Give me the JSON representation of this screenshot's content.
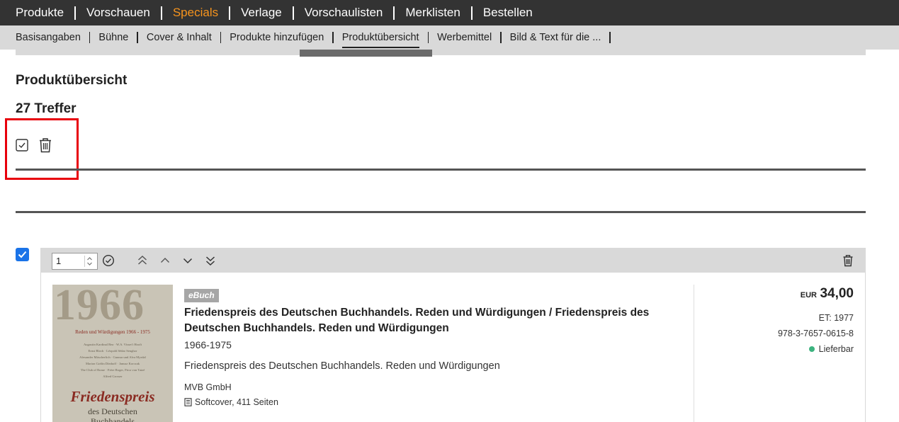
{
  "top_nav": {
    "items": [
      {
        "label": "Produkte",
        "active": false
      },
      {
        "label": "Vorschauen",
        "active": false
      },
      {
        "label": "Specials",
        "active": true
      },
      {
        "label": "Verlage",
        "active": false
      },
      {
        "label": "Vorschaulisten",
        "active": false
      },
      {
        "label": "Merklisten",
        "active": false
      },
      {
        "label": "Bestellen",
        "active": false
      }
    ],
    "active_color": "#f7941d"
  },
  "sub_nav": {
    "items": [
      {
        "label": "Basisangaben",
        "active": false
      },
      {
        "label": "Bühne",
        "active": false
      },
      {
        "label": "Cover & Inhalt",
        "active": false
      },
      {
        "label": "Produkte hinzufügen",
        "active": false
      },
      {
        "label": "Produktübersicht",
        "active": true
      },
      {
        "label": "Werbemittel",
        "active": false
      },
      {
        "label": "Bild & Text für die ...",
        "active": false
      }
    ]
  },
  "main": {
    "title": "Produktübersicht",
    "hit_count": "27 Treffer",
    "toolbar": {
      "select_all_icon": "checkbox-check-icon",
      "delete_icon": "trash-icon"
    },
    "highlight_color": "#e8000b"
  },
  "product": {
    "selected": true,
    "quantity": "1",
    "badge": "eBuch",
    "title": "Friedenspreis des Deutschen Buchhandels. Reden und Würdigungen / Friedenspreis des Deutschen Buchhandels. Reden und Würdigungen",
    "years": "1966-1975",
    "description": "Friedenspreis des Deutschen Buchhandels. Reden und Würdigungen",
    "publisher": "MVB GmbH",
    "format": "Softcover, 411 Seiten",
    "currency": "EUR",
    "price": "34,00",
    "release": "ET: 1977",
    "isbn": "978-3-7657-0615-8",
    "availability": "Lieferbar",
    "availability_color": "#3cb37f",
    "cover": {
      "year": "1966",
      "subtitle": "Reden und Würdigungen 1966 - 1975",
      "names": [
        "Augustin Kardinal Bea · W.A. Visser't Hooft",
        "Ernst Bloch · Léopold Sédar Senghor",
        "Alexander Mitscherlich · Gunnar und Alva Myrdal",
        "Marion Gräfin Dönhoff · Janusz Korczak",
        "The Club of Rome · Frère Roger, Prior von Taizé",
        "Alfred Grosser"
      ],
      "title_line1": "Friedenspreis",
      "title_line2": "des Deutschen",
      "title_line3": "Buchhandels"
    }
  }
}
